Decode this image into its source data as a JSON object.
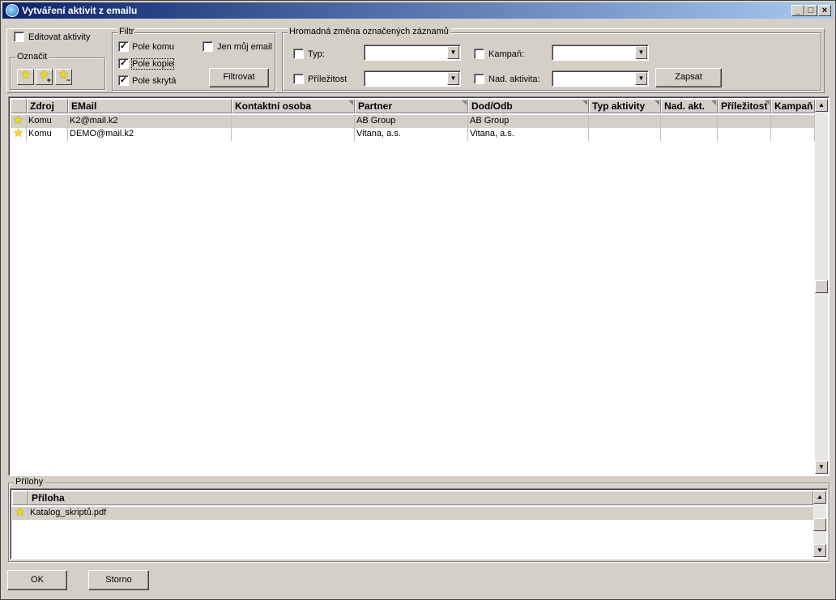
{
  "window": {
    "title": "Vytváření aktivit z emailu",
    "controls": [
      "_",
      "□",
      "×"
    ]
  },
  "options": {
    "edit_activities_label": "Editovat aktivity",
    "edit_activities_checked": false
  },
  "mark": {
    "group_label": "Označit",
    "buttons": [
      {
        "icon": "star-icon",
        "modifier": ""
      },
      {
        "icon": "star-plus-icon",
        "modifier": "+"
      },
      {
        "icon": "star-minus-icon",
        "modifier": "−"
      }
    ]
  },
  "filter": {
    "group_label": "Filtr",
    "to_label": "Pole komu",
    "to_checked": true,
    "cc_label": "Pole kopie",
    "cc_checked": true,
    "bcc_label": "Pole skrytá",
    "bcc_checked": true,
    "my_email_label": "Jen můj email",
    "my_email_checked": false,
    "filter_button": "Filtrovat"
  },
  "bulk": {
    "group_label": "Hromadná změna označených záznamů",
    "type_label": "Typ:",
    "type_value": "",
    "campaign_label": "Kampaň:",
    "campaign_value": "",
    "opportunity_label": "Příležitost",
    "opportunity_value": "",
    "parent_activity_label": "Nad. aktivita:",
    "parent_activity_value": "",
    "save_button": "Zapsat"
  },
  "grid": {
    "columns": [
      "Zdroj",
      "EMail",
      "Kontaktní osoba",
      "Partner",
      "Dod/Odb",
      "Typ aktivity",
      "Nad. akt.",
      "Příležitost",
      "Kampaň"
    ],
    "rows": [
      {
        "source": "Komu",
        "email": "K2@mail.k2",
        "contact": "",
        "partner": "AB Group",
        "dod_odb": "AB Group",
        "activity_type": "",
        "parent": "",
        "opportunity": "",
        "campaign": "",
        "selected": true
      },
      {
        "source": "Komu",
        "email": "DEMO@mail.k2",
        "contact": "",
        "partner": "Vitana, a.s.",
        "dod_odb": "Vitana, a.s.",
        "activity_type": "",
        "parent": "",
        "opportunity": "",
        "campaign": "",
        "selected": false
      }
    ]
  },
  "attachments": {
    "group_label": "Přílohy",
    "column": "Příloha",
    "rows": [
      {
        "name": "Katalog_skriptů.pdf",
        "selected": true
      }
    ]
  },
  "footer": {
    "ok_button": "OK",
    "cancel_button": "Storno"
  },
  "colors": {
    "title_start": "#0a246a",
    "title_end": "#a6caf0",
    "face": "#d4d0c8",
    "star": "#f2dc10"
  }
}
